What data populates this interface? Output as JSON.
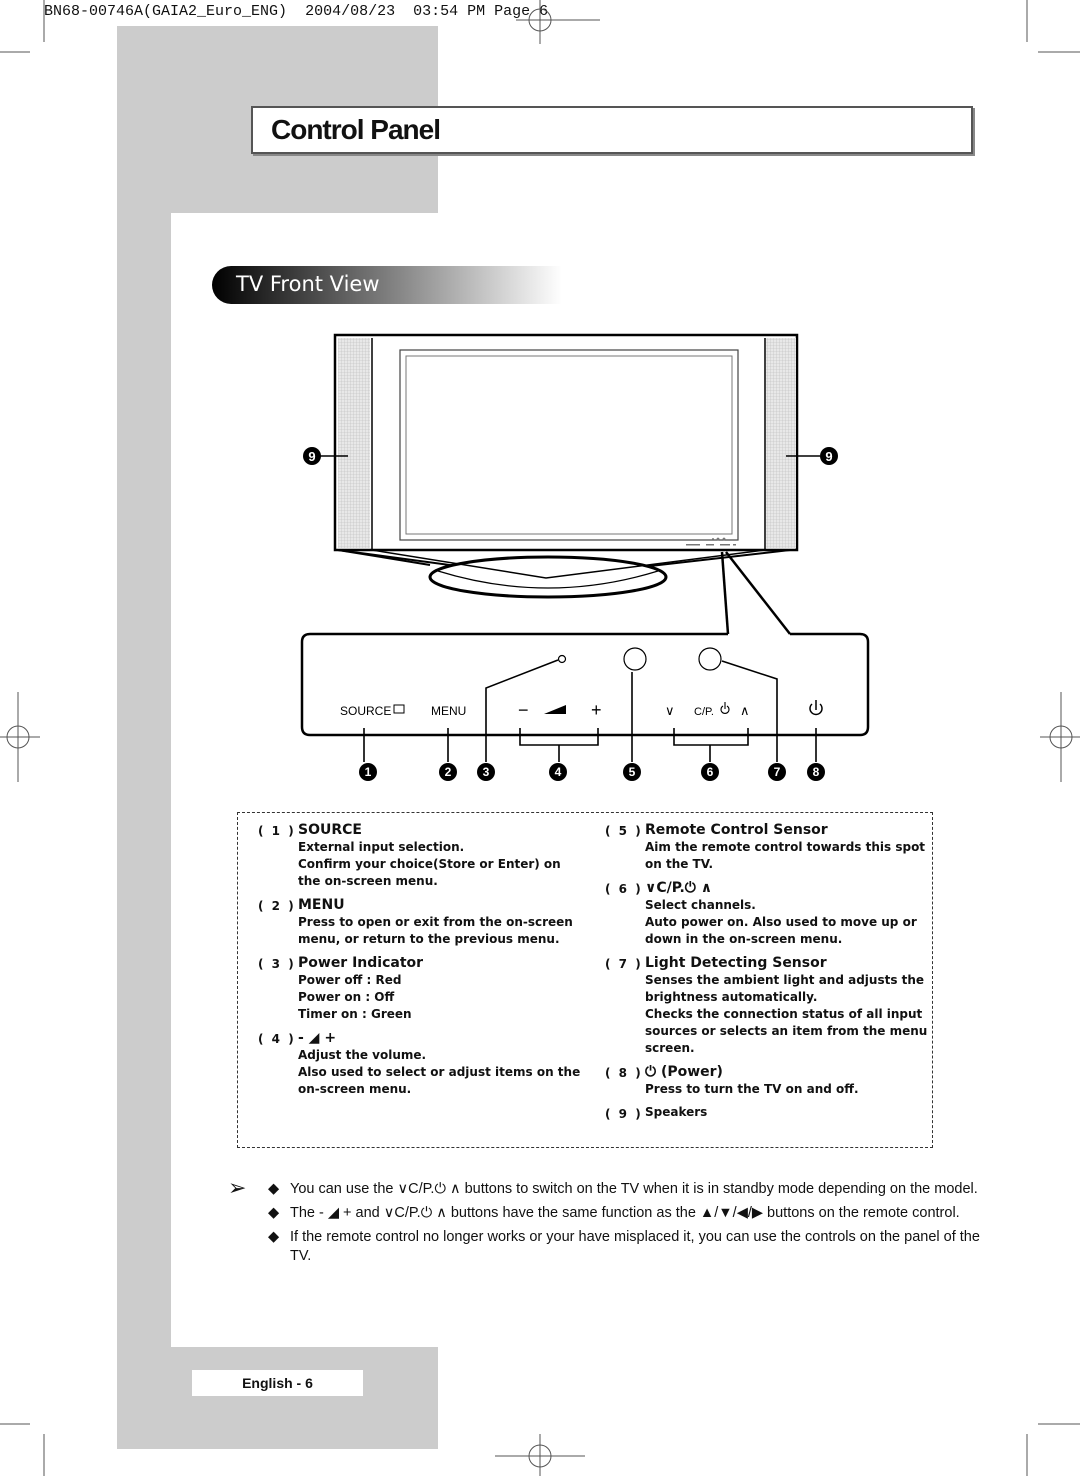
{
  "print_header": {
    "job": "BN68-00746A(GAIA2_Euro_ENG)",
    "date": "2004/08/23",
    "time": "03:54 PM",
    "page": "Page 6"
  },
  "title": "Control Panel",
  "section": "TV Front View",
  "diagram": {
    "panel_labels": {
      "source": "SOURCE",
      "menu": "MENU",
      "minus": "−",
      "plus": "+",
      "channel_down": "∨",
      "cp": "C/P.",
      "channel_up": "∧"
    },
    "callouts": [
      "1",
      "2",
      "3",
      "4",
      "5",
      "6",
      "7",
      "8"
    ],
    "speaker_callout": "9"
  },
  "descriptions": {
    "left": [
      {
        "num": "( 1 )",
        "head": "SOURCE",
        "icon": "source-input-icon",
        "lines": [
          "External input selection.",
          "Confirm your choice(Store or Enter) on",
          "the on-screen menu."
        ]
      },
      {
        "num": "( 2 )",
        "head": "MENU",
        "lines": [
          "Press to open or exit from the on-screen",
          "menu, or return to the previous menu."
        ]
      },
      {
        "num": "( 3 )",
        "head": "Power Indicator",
        "lines": [
          "Power off : Red",
          "Power on : Off",
          "Timer on : Green"
        ]
      },
      {
        "num": "( 4 )",
        "head": "-  ◢  +",
        "lines": [
          "Adjust the volume.",
          "Also used to select or adjust items on the",
          "on-screen menu."
        ]
      }
    ],
    "right": [
      {
        "num": "( 5 )",
        "head": "Remote Control Sensor",
        "lines": [
          "Aim the remote control towards this spot",
          "on the TV."
        ]
      },
      {
        "num": "( 6 )",
        "head": "∨C/P.⏻  ∧",
        "lines": [
          "Select channels.",
          "Auto power on. Also used to move up or",
          "down in the on-screen menu."
        ]
      },
      {
        "num": "( 7 )",
        "head": "Light Detecting Sensor",
        "lines": [
          "Senses the ambient light and adjusts the",
          "brightness automatically.",
          "Checks the connection status of all input",
          "sources or selects an item from the menu",
          "screen."
        ]
      },
      {
        "num": "( 8 )",
        "head": "⏻ (Power)",
        "lines": [
          "Press to turn the TV on and off."
        ]
      },
      {
        "num": "( 9 )",
        "head": "",
        "lines": [
          "Speakers"
        ]
      }
    ]
  },
  "notes": [
    "You can use the ∨C/P.⏻  ∧ buttons to switch on the TV when it is in standby mode depending on the model.",
    "The -  ◢  + and ∨C/P.⏻  ∧ buttons have the same function as the ▲/▼/◀/▶ buttons on the remote control.",
    "If the remote control no longer works or your have misplaced it, you can use the controls on the panel of the TV."
  ],
  "note_marker": "➢",
  "bullet": "◆",
  "footer": "English - 6"
}
